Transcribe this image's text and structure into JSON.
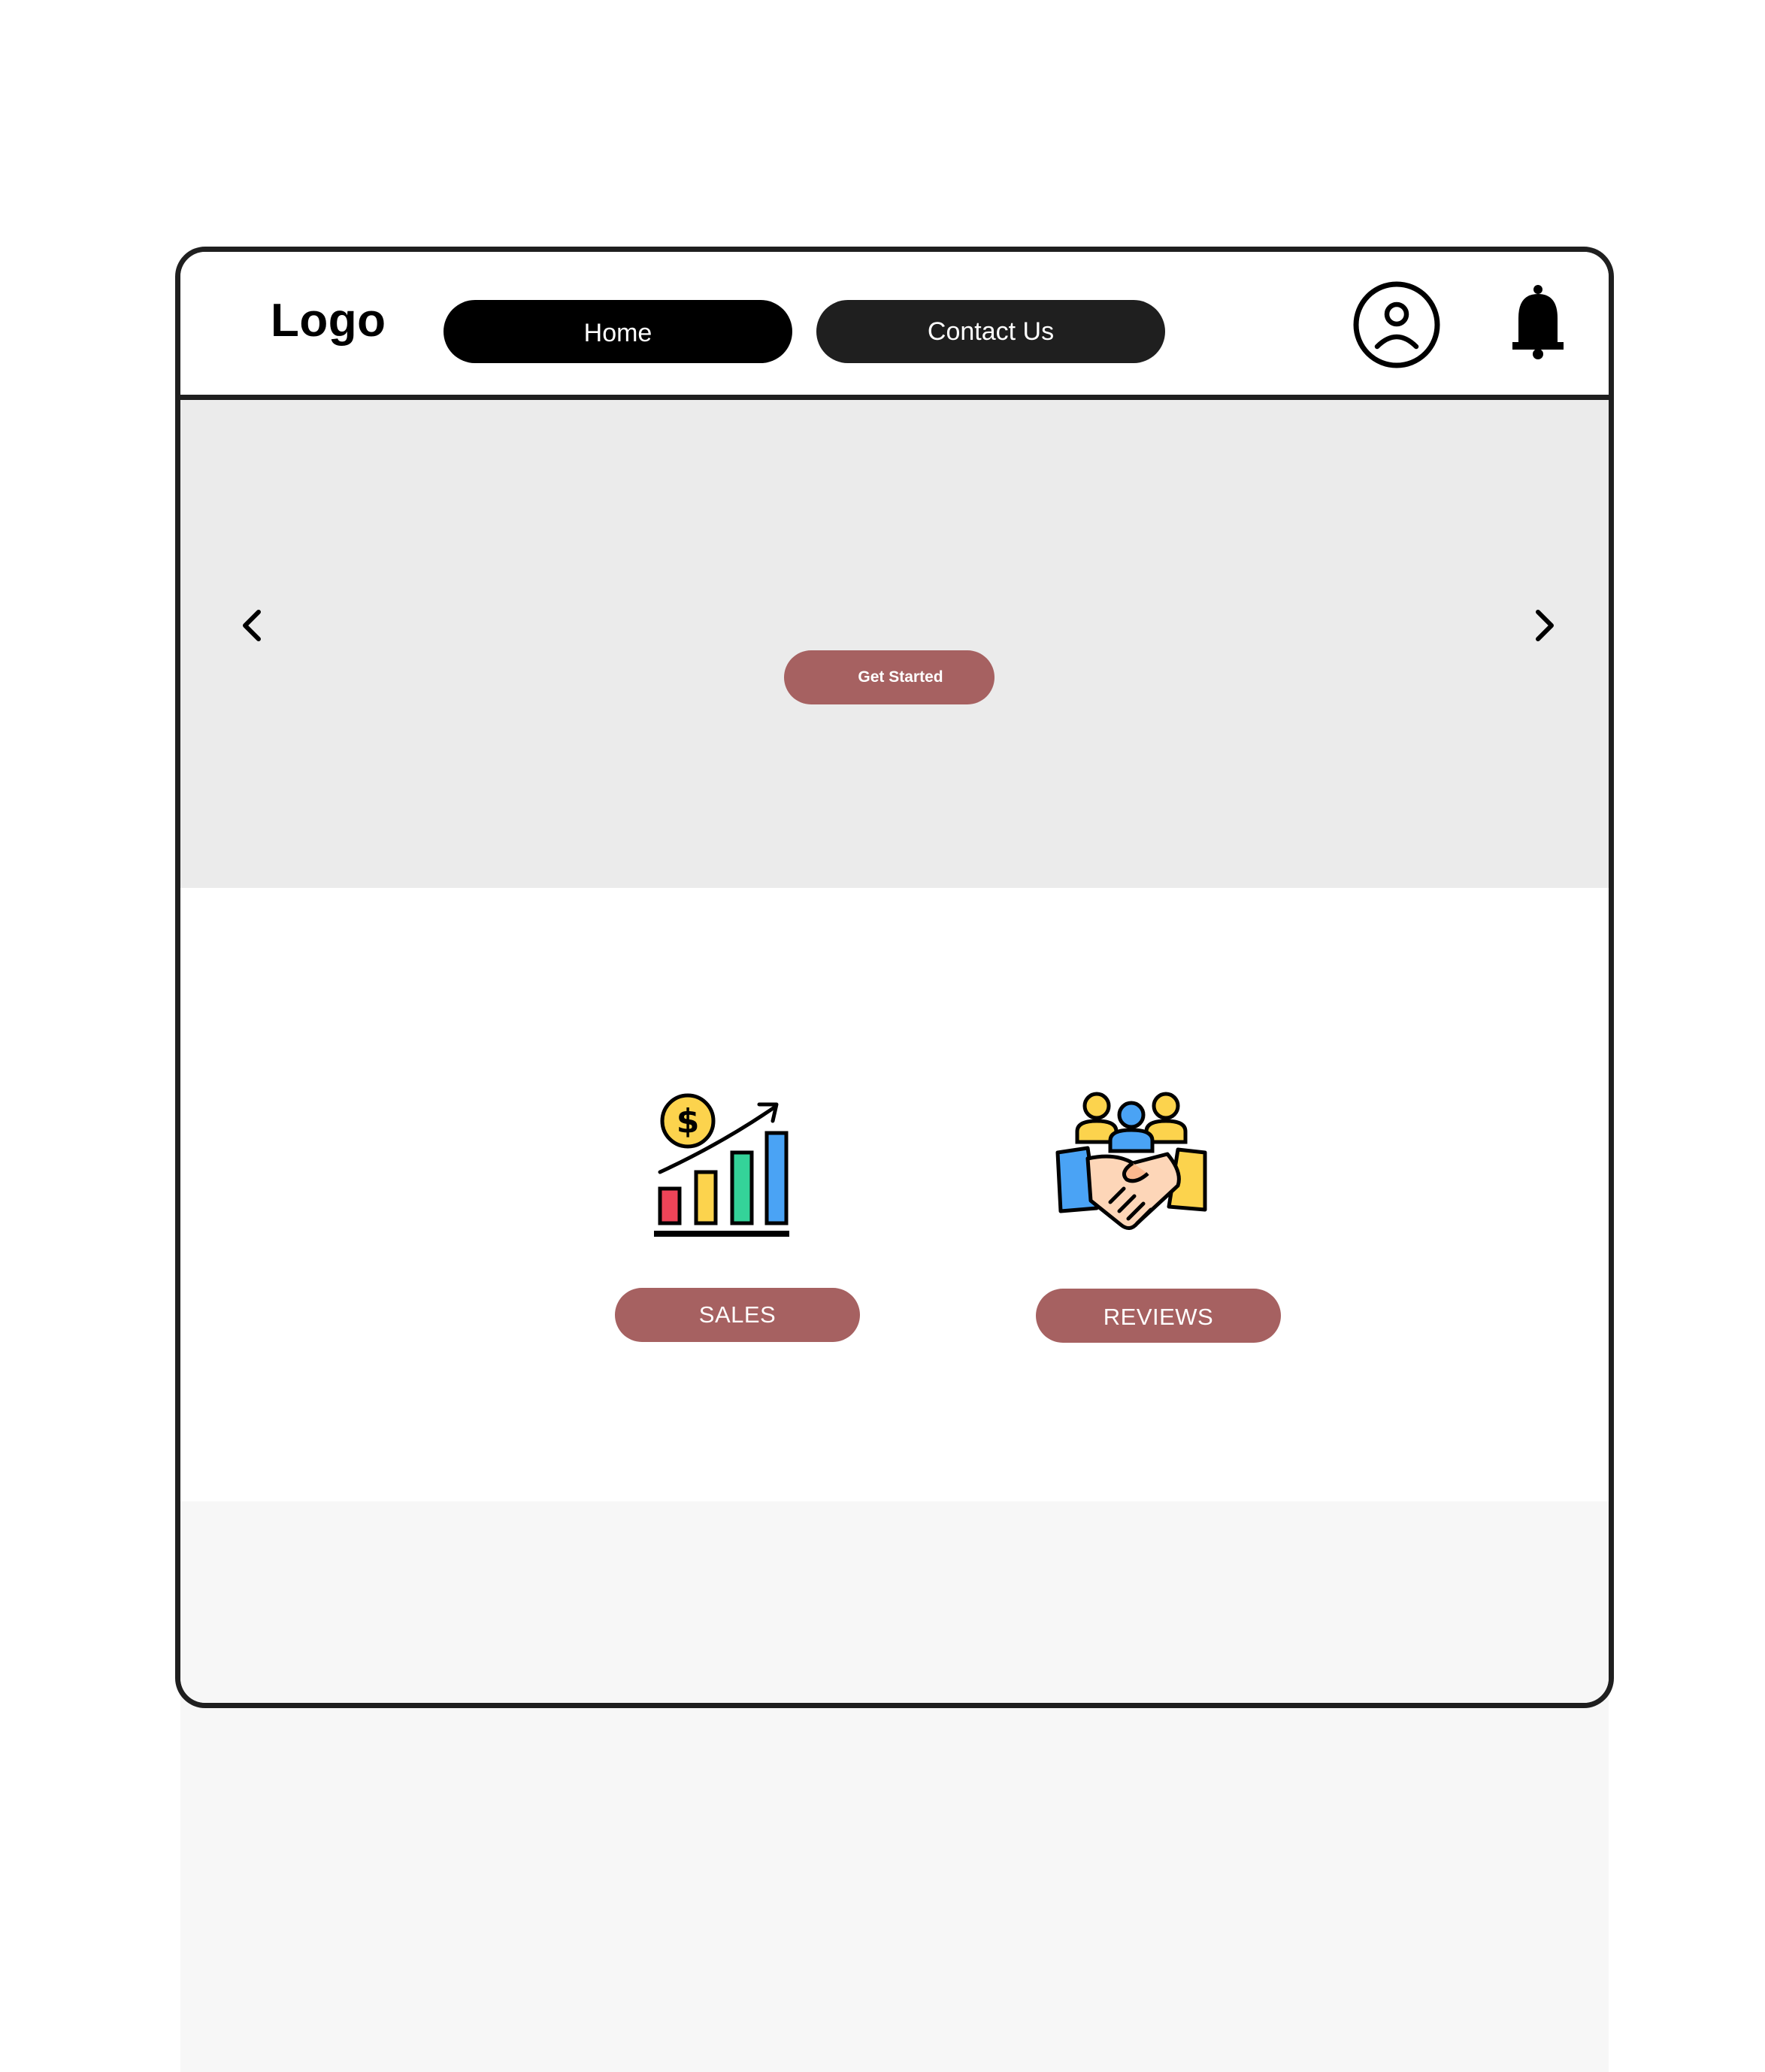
{
  "header": {
    "logo_text": "Logo",
    "nav": {
      "home_label": "Home",
      "contact_label": "Contact Us"
    },
    "icons": {
      "profile": "user-circle-icon",
      "notifications": "bell-icon"
    }
  },
  "hero": {
    "cta_label": "Get Started",
    "prev_icon": "chevron-left-icon",
    "next_icon": "chevron-right-icon"
  },
  "features": {
    "items": [
      {
        "label": "SALES",
        "icon": "sales-growth-chart-icon"
      },
      {
        "label": "REVIEWS",
        "icon": "handshake-team-icon"
      }
    ]
  },
  "colors": {
    "accent": "#a66161",
    "frame": "#1f1f1f",
    "hero_bg": "#ebebeb",
    "footer_bg": "#f7f7f7"
  }
}
